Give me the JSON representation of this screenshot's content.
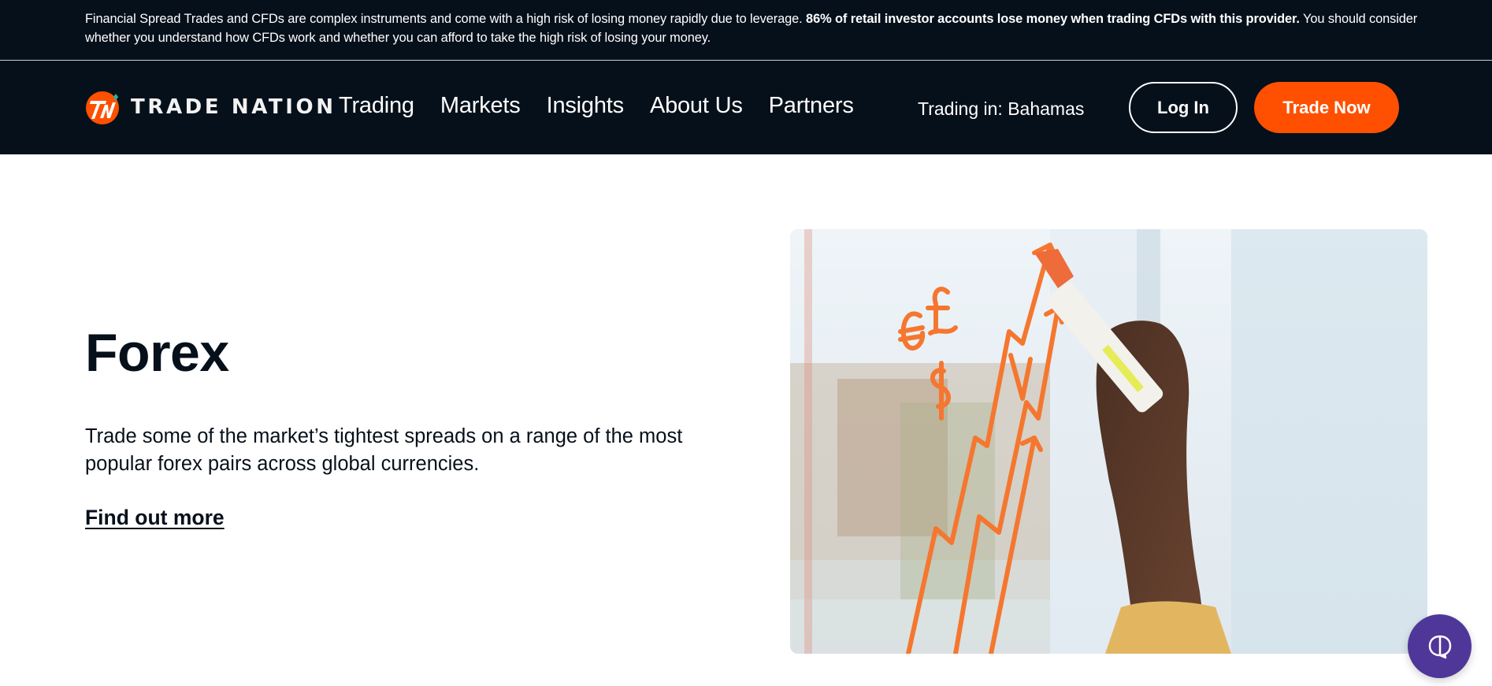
{
  "risk_banner": {
    "text_before": "Financial Spread Trades and CFDs are complex instruments and come with a high risk of losing money rapidly due to leverage. ",
    "text_bold": "86% of retail investor accounts lose money when trading CFDs with this provider.",
    "text_after": " You should consider whether you understand how CFDs work and whether you can afford to take the high risk of losing your money."
  },
  "header": {
    "logo_text": "TRADE NATION",
    "logo_icon": "tn-logo-icon",
    "nav": [
      {
        "label": "Trading"
      },
      {
        "label": "Markets"
      },
      {
        "label": "Insights"
      },
      {
        "label": "About Us"
      },
      {
        "label": "Partners"
      }
    ],
    "trading_in": "Trading in: Bahamas",
    "login_label": "Log In",
    "trade_now_label": "Trade Now"
  },
  "hero": {
    "title": "Forex",
    "description": "Trade some of the market’s tightest spreads on a range of the most popular forex pairs across global currencies.",
    "link_label": "Find out more",
    "image_alt": "Hand drawing currency symbols and rising arrows on glass with orange marker"
  },
  "chat": {
    "icon": "chat-bubble-icon"
  },
  "colors": {
    "dark": "#06101b",
    "accent": "#fe5000",
    "chat": "#4f3799"
  }
}
